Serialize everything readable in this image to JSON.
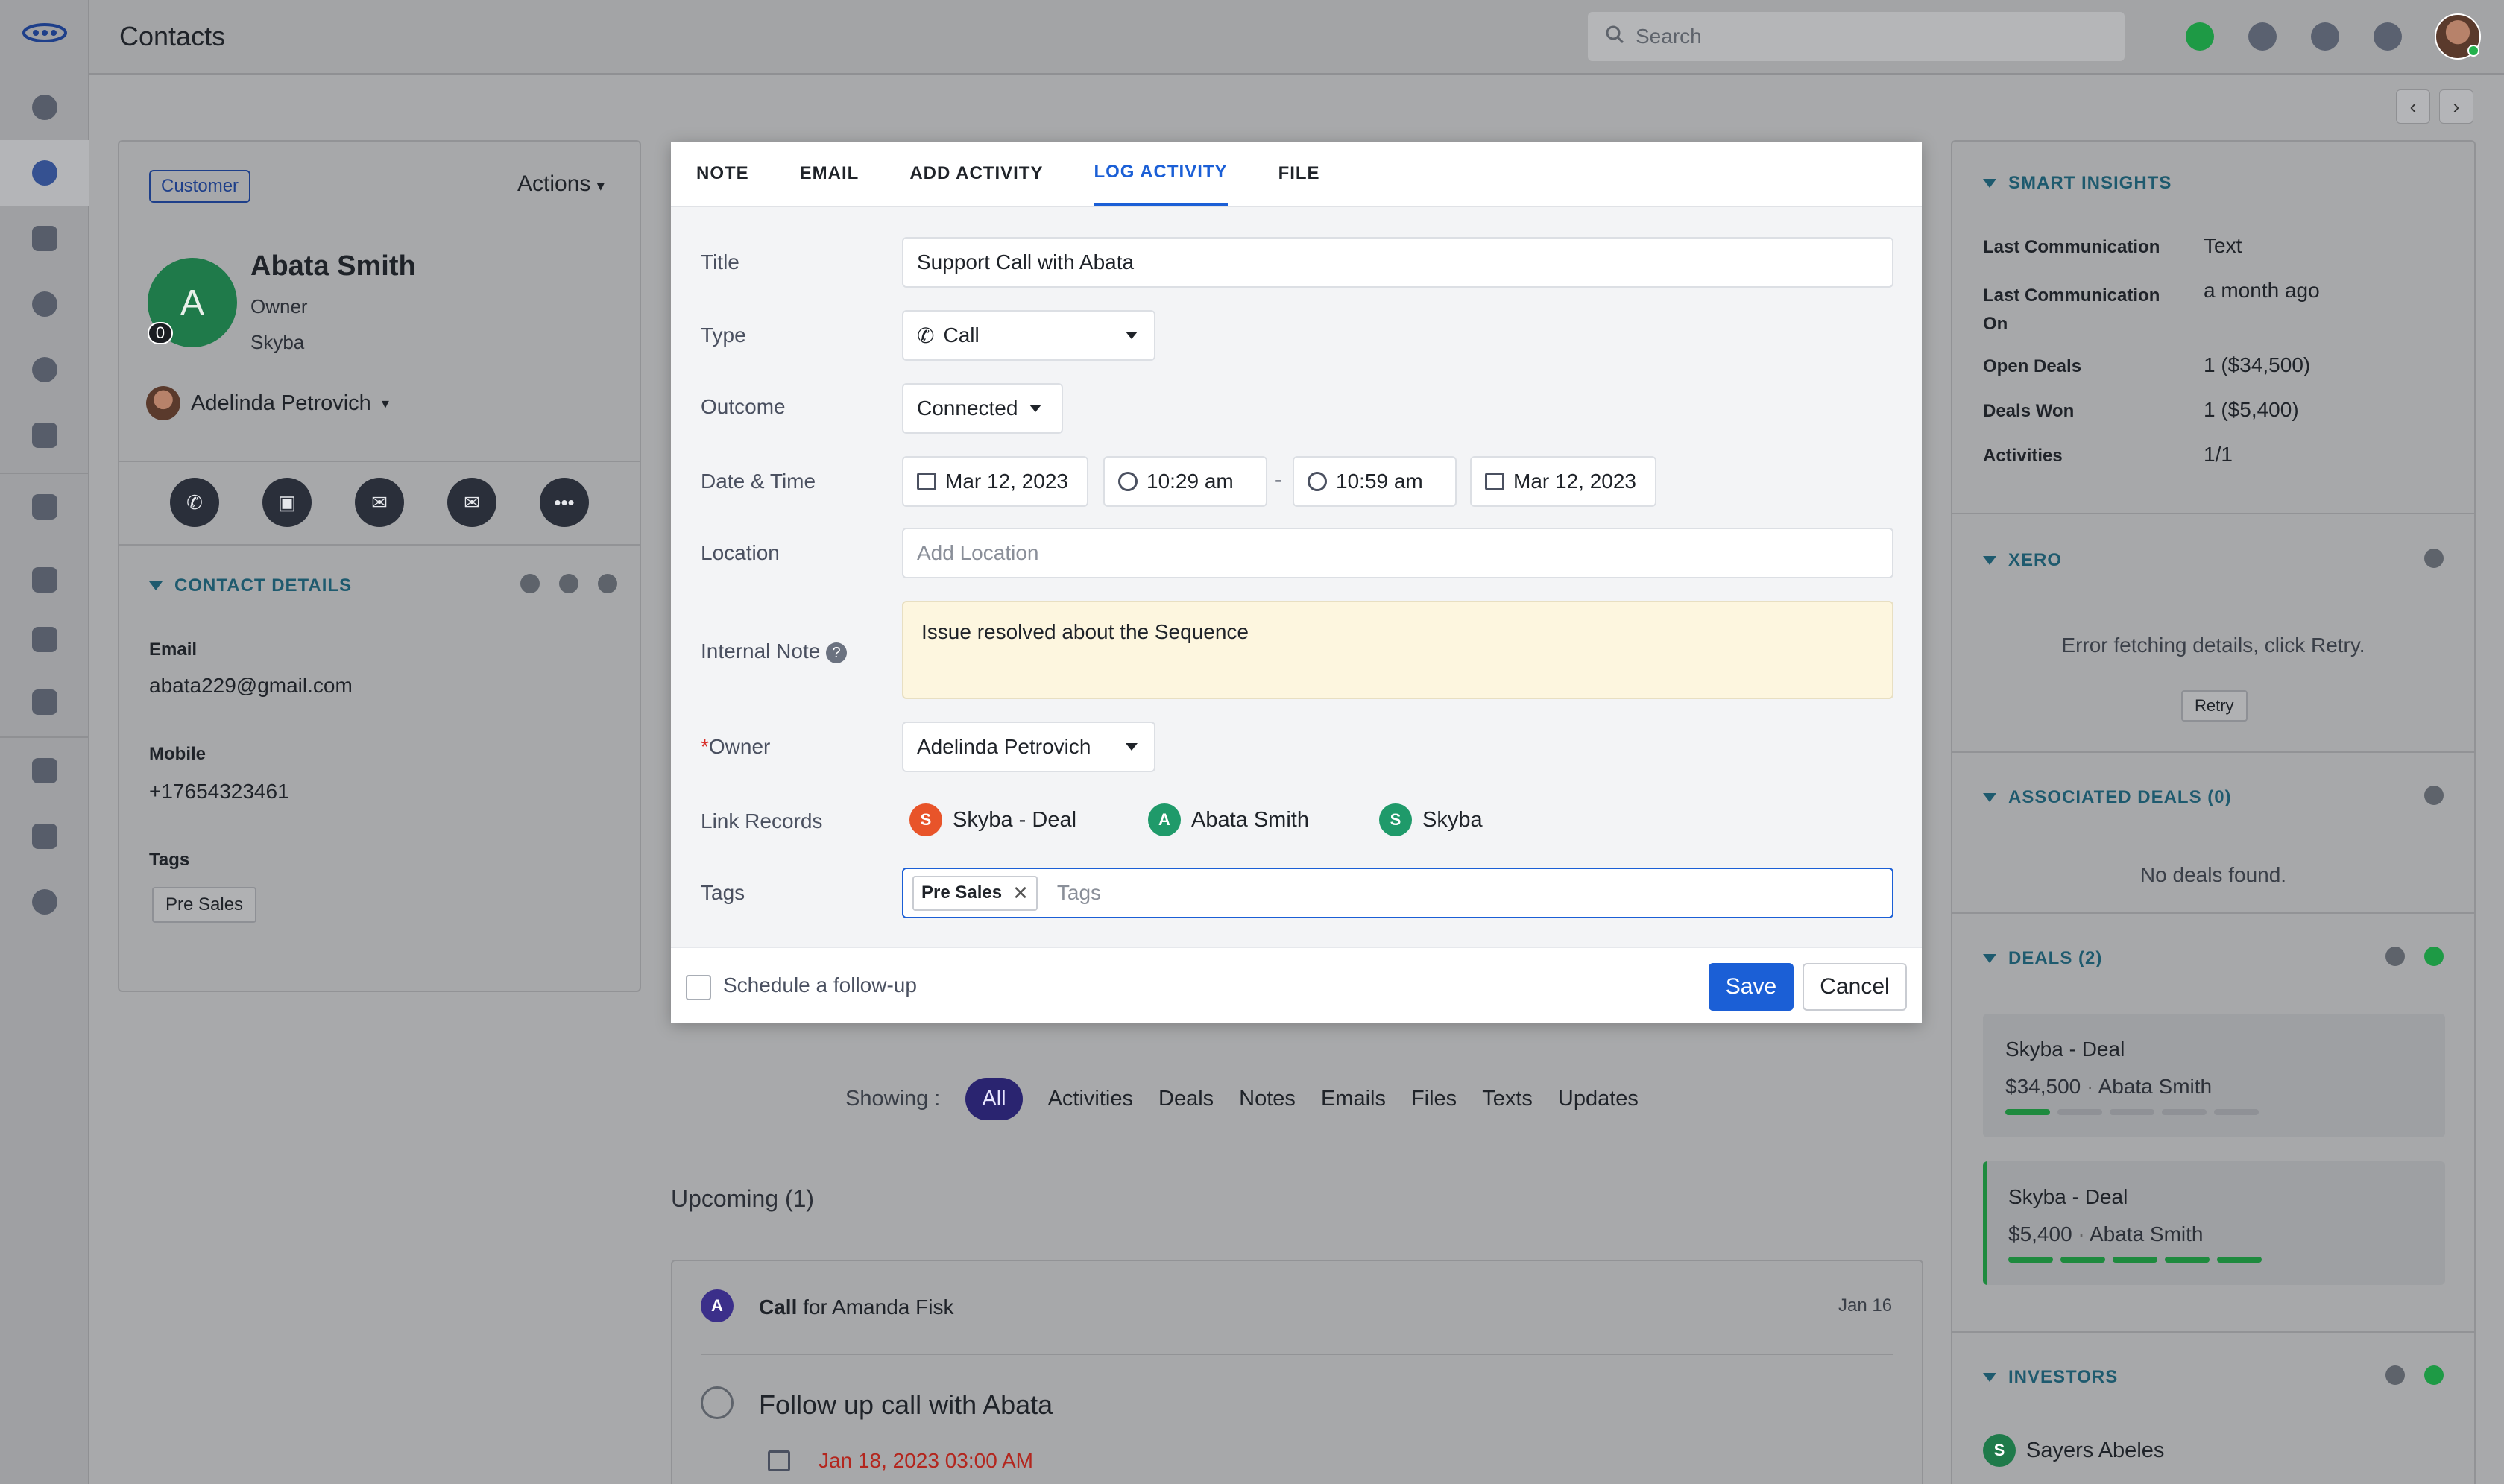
{
  "app": {
    "title": "Contacts"
  },
  "search": {
    "placeholder": "Search"
  },
  "contact": {
    "badge": "Customer",
    "actions_label": "Actions",
    "avatar_letter": "A",
    "unread_count": "0",
    "name": "Abata Smith",
    "role": "Owner",
    "company": "Skyba",
    "owner_name": "Adelinda Petrovich"
  },
  "contact_details": {
    "title": "CONTACT DETAILS",
    "email_label": "Email",
    "email_value": "abata229@gmail.com",
    "mobile_label": "Mobile",
    "mobile_value": "+17654323461",
    "tags_label": "Tags",
    "tag": "Pre Sales"
  },
  "modal": {
    "tabs": [
      "NOTE",
      "EMAIL",
      "ADD ACTIVITY",
      "LOG ACTIVITY",
      "FILE"
    ],
    "active_tab": "LOG ACTIVITY",
    "title_label": "Title",
    "title_value": "Support Call with Abata",
    "type_label": "Type",
    "type_value": "Call",
    "outcome_label": "Outcome",
    "outcome_value": "Connected",
    "datetime_label": "Date & Time",
    "start_date": "Mar 12, 2023",
    "start_time": "10:29 am",
    "dash": "-",
    "end_time": "10:59 am",
    "end_date": "Mar 12, 2023",
    "location_label": "Location",
    "location_placeholder": "Add Location",
    "note_label": "Internal Note",
    "note_value": "Issue resolved about the Sequence",
    "owner_label_star": "*",
    "owner_label": "Owner",
    "owner_value": "Adelinda Petrovich",
    "link_label": "Link Records",
    "links": [
      {
        "letter": "S",
        "name": "Skyba - Deal",
        "color": "#e8542a"
      },
      {
        "letter": "A",
        "name": "Abata Smith",
        "color": "#1f9a6a"
      },
      {
        "letter": "S",
        "name": "Skyba",
        "color": "#1f9a6a"
      }
    ],
    "tags_label": "Tags",
    "tag_chip": "Pre Sales",
    "tags_placeholder": "Tags",
    "followup_label": "Schedule a follow-up",
    "save_label": "Save",
    "cancel_label": "Cancel"
  },
  "filters": {
    "showing_label": "Showing :",
    "items": [
      "All",
      "Activities",
      "Deals",
      "Notes",
      "Emails",
      "Files",
      "Texts",
      "Updates"
    ]
  },
  "timeline": {
    "upcoming_label": "Upcoming (1)",
    "item1_letter": "A",
    "item1_title_bold": "Call",
    "item1_title_rest": "for Amanda Fisk",
    "item1_date": "Jan 16",
    "item2_title": "Follow up call with Abata",
    "item2_due": "Jan 18, 2023 03:00 AM"
  },
  "insights": {
    "title": "SMART INSIGHTS",
    "rows": [
      {
        "label": "Last Communication",
        "value": "Text"
      },
      {
        "label": "Last Communication On",
        "value": "a month ago"
      },
      {
        "label": "Open Deals",
        "value": "1 ($34,500)"
      },
      {
        "label": "Deals Won",
        "value": "1 ($5,400)"
      },
      {
        "label": "Activities",
        "value": "1/1"
      }
    ]
  },
  "xero": {
    "title": "XERO",
    "error": "Error fetching details, click Retry.",
    "retry_label": "Retry"
  },
  "associated_deals": {
    "title": "ASSOCIATED DEALS (0)",
    "empty": "No deals found."
  },
  "deals": {
    "title": "DEALS (2)",
    "items": [
      {
        "name": "Skyba - Deal",
        "amount": "$34,500",
        "contact": "Abata Smith",
        "stage_progress": 0.2
      },
      {
        "name": "Skyba - Deal",
        "amount": "$5,400",
        "contact": "Abata Smith",
        "stage_progress": 1.0
      }
    ]
  },
  "investors": {
    "title": "INVESTORS",
    "items": [
      {
        "letter": "S",
        "name": "Sayers Abeles"
      }
    ]
  },
  "colors": {
    "primary": "#1b5fd6",
    "success": "#1e9a45",
    "section": "#1e5a6e"
  }
}
